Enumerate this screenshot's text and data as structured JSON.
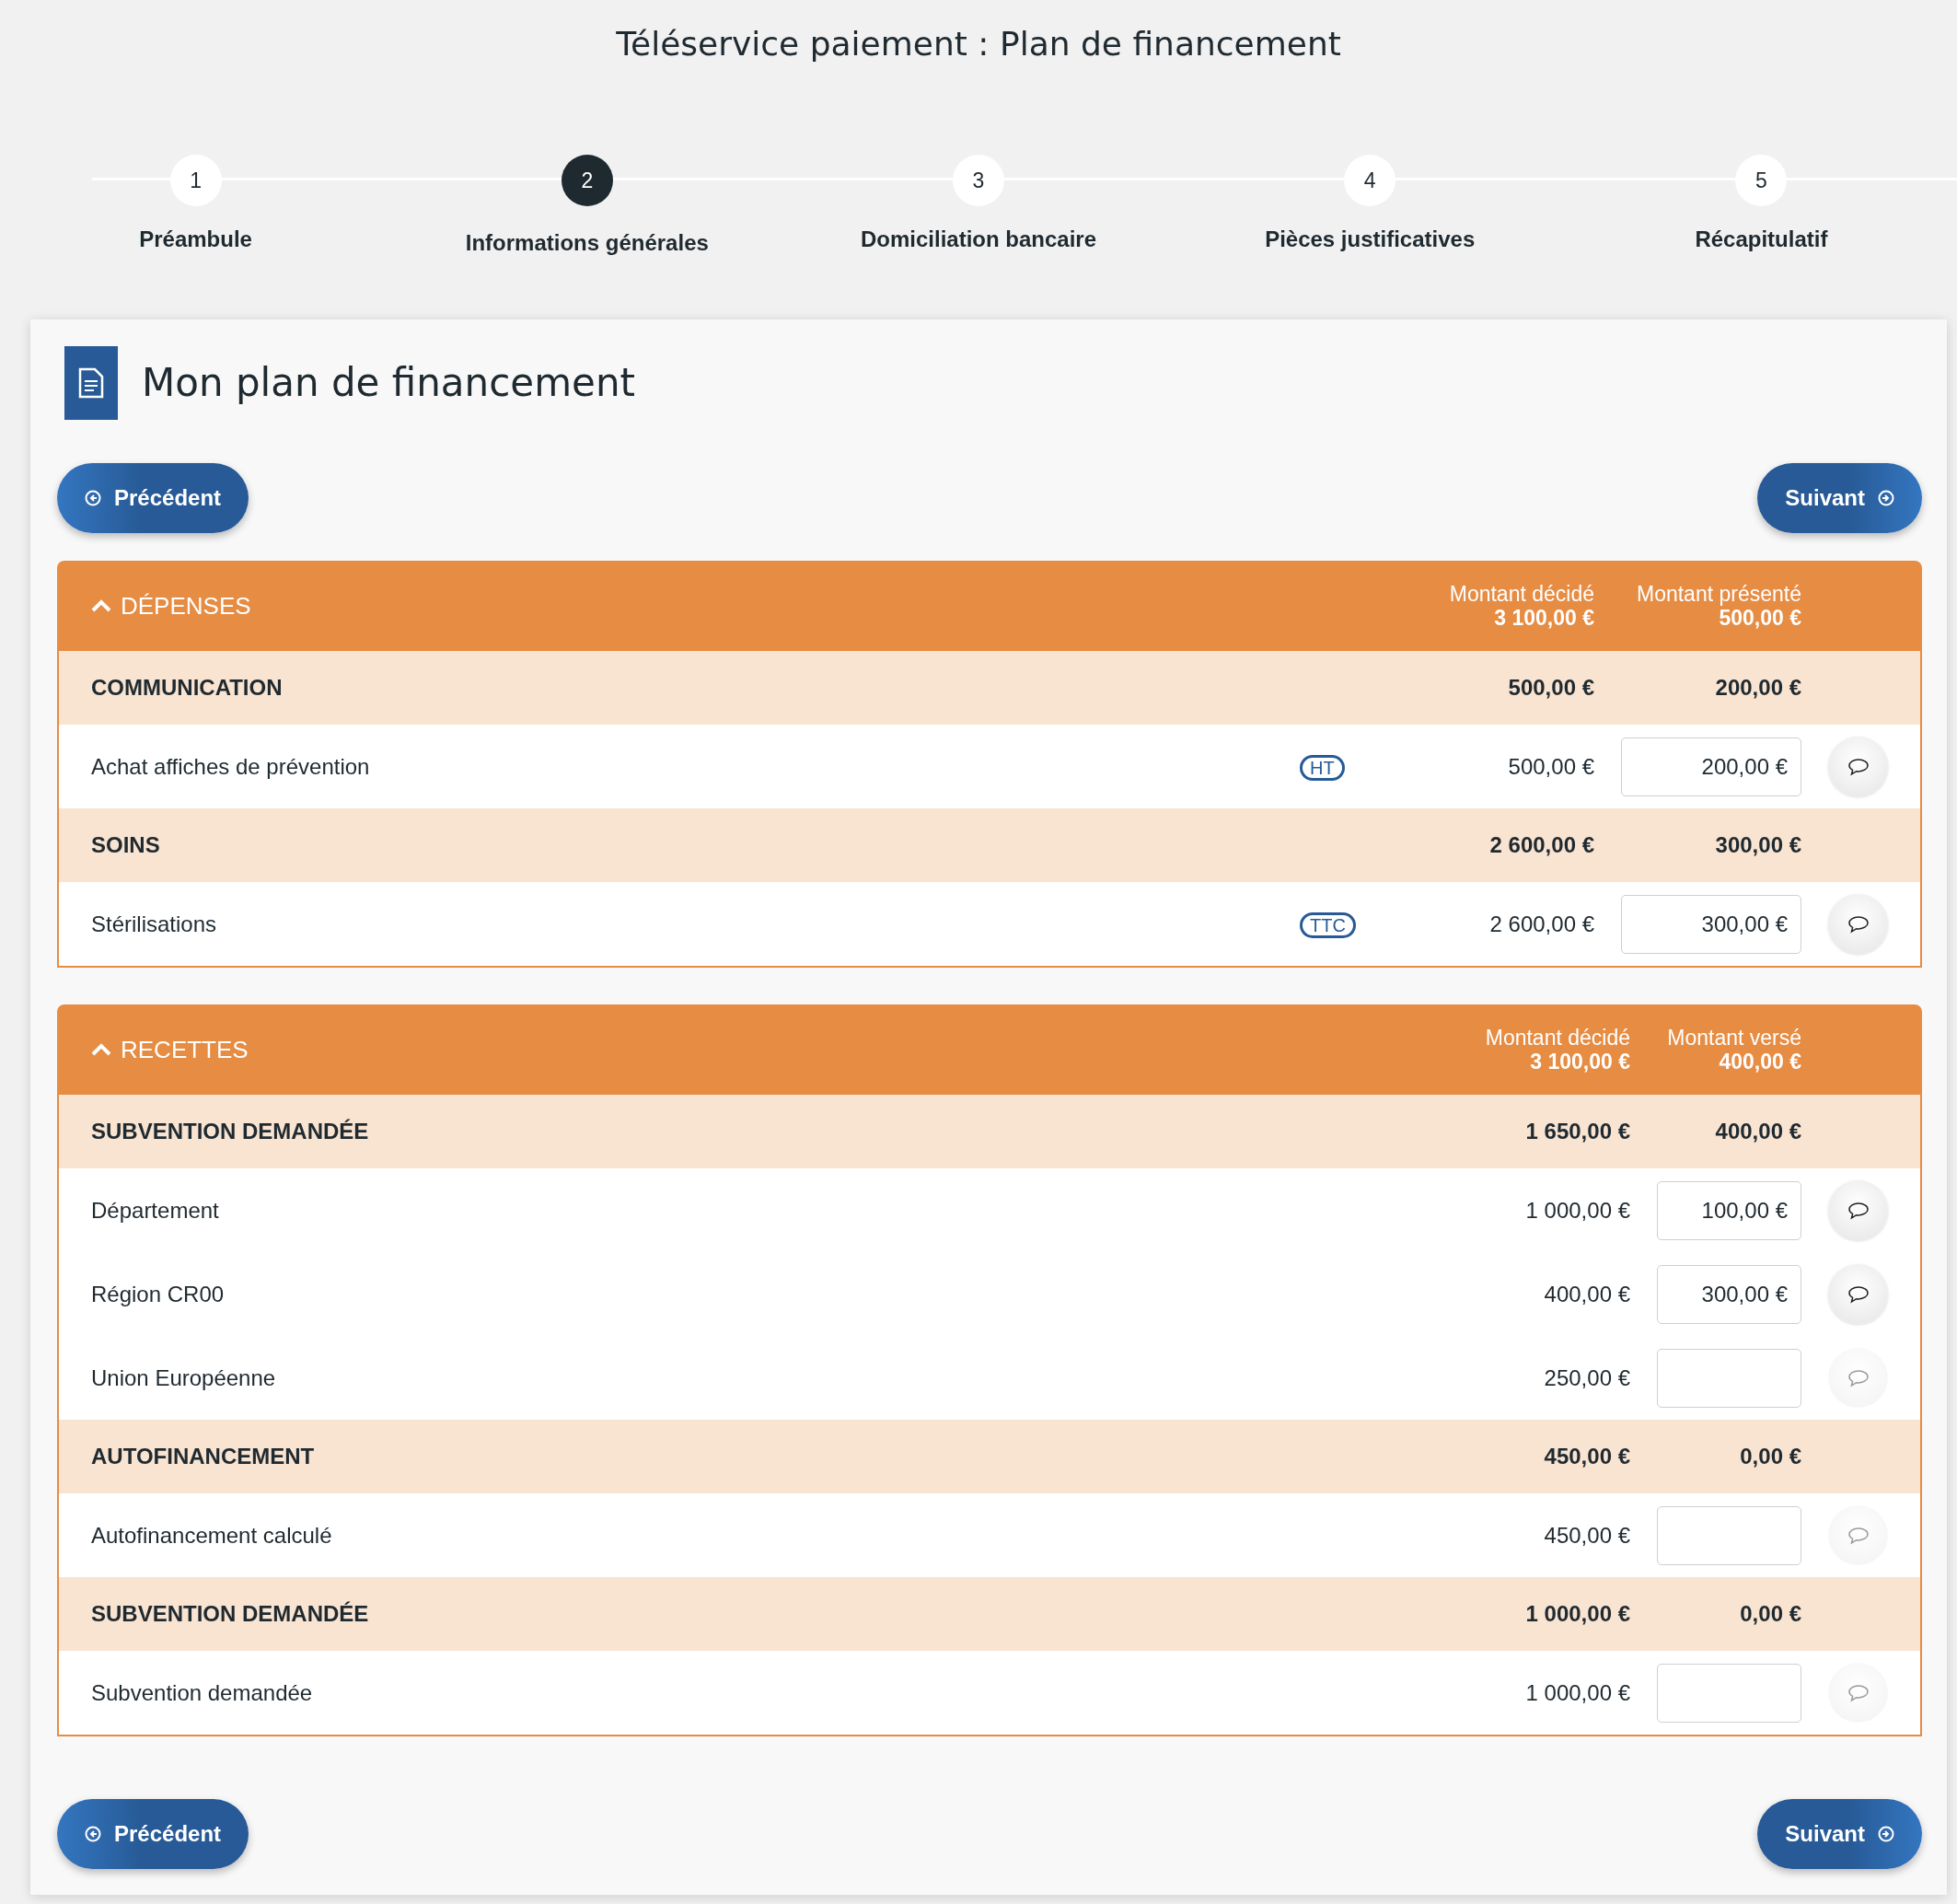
{
  "title": "Téléservice paiement : Plan de financement",
  "steps": [
    {
      "number": "1",
      "label": "Préambule",
      "selected": false
    },
    {
      "number": "2",
      "label": "Informations générales",
      "selected": true
    },
    {
      "number": "3",
      "label": "Domiciliation bancaire",
      "selected": false
    },
    {
      "number": "4",
      "label": "Pièces justificatives",
      "selected": false
    },
    {
      "number": "5",
      "label": "Récapitulatif",
      "selected": false
    }
  ],
  "heading": "Mon plan de financement",
  "nav_top": {
    "previous": "Précédent",
    "next": "Suivant"
  },
  "sections": [
    {
      "title": "DÉPENSES",
      "expanded": true,
      "columns": [
        {
          "label": "Montant décidé",
          "total": "3 100,00 €"
        },
        {
          "label": "Montant présenté",
          "total": "500,00 €"
        }
      ],
      "groups": [
        {
          "name": "COMMUNICATION",
          "decided": "500,00 €",
          "amount": "200,00 €",
          "items": [
            {
              "label": "Achat affiches de prévention",
              "tag": "HT",
              "decided": "500,00 €",
              "value": "200,00 €",
              "disabled": false
            }
          ]
        },
        {
          "name": "SOINS",
          "decided": "2 600,00 €",
          "amount": "300,00 €",
          "items": [
            {
              "label": "Stérilisations",
              "tag": "TTC",
              "decided": "2 600,00 €",
              "value": "300,00 €",
              "disabled": false
            }
          ]
        }
      ]
    },
    {
      "title": "RECETTES",
      "expanded": true,
      "columns": [
        {
          "label": "Montant décidé",
          "total": "3 100,00 €"
        },
        {
          "label": "Montant versé",
          "total": "400,00 €"
        }
      ],
      "groups": [
        {
          "name": "SUBVENTION DEMANDÉE",
          "decided": "1 650,00 €",
          "amount": "400,00 €",
          "items": [
            {
              "label": "Département",
              "decided": "1 000,00 €",
              "value": "100,00 €",
              "disabled": false
            },
            {
              "label": "Région CR00",
              "decided": "400,00 €",
              "value": "300,00 €",
              "disabled": false
            },
            {
              "label": "Union Européenne",
              "decided": "250,00 €",
              "disabled": true
            }
          ]
        },
        {
          "name": "AUTOFINANCEMENT",
          "decided": "450,00 €",
          "amount": "0,00 €",
          "items": [
            {
              "label": "Autofinancement calculé",
              "decided": "450,00 €",
              "disabled": true
            }
          ]
        },
        {
          "name": "SUBVENTION DEMANDÉE",
          "decided": "1 000,00 €",
          "amount": "0,00 €",
          "items": [
            {
              "label": "Subvention demandée",
              "decided": "1 000,00 €",
              "disabled": true
            }
          ]
        }
      ]
    }
  ],
  "nav_bottom": {
    "previous": "Précédent",
    "next": "Suivant"
  }
}
